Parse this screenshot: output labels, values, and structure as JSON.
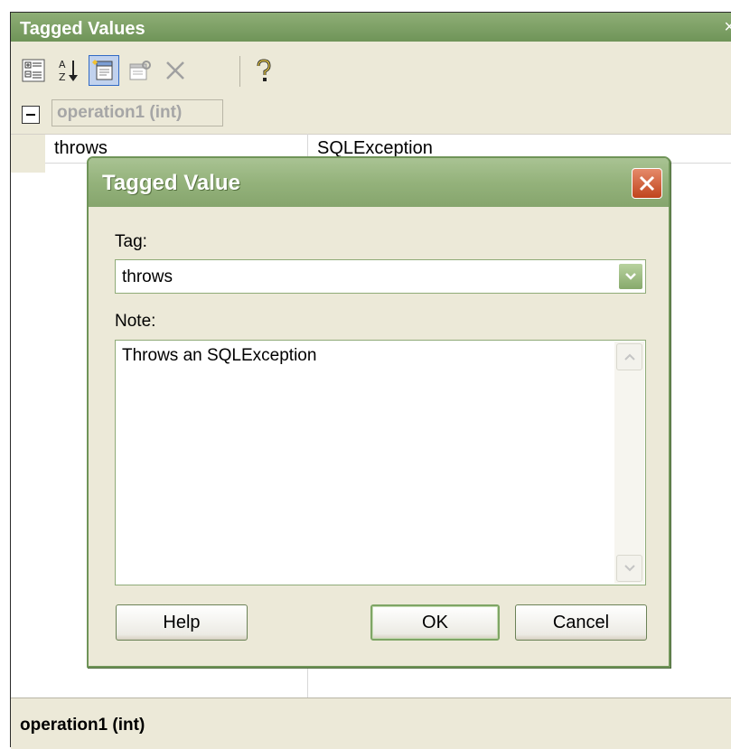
{
  "panel": {
    "title": "Tagged Values",
    "close_glyph": "×",
    "toolbar": {
      "buttons": [
        {
          "name": "categorized-icon"
        },
        {
          "name": "sort-alphabetical-icon"
        },
        {
          "name": "new-tagged-value-icon",
          "active": true
        },
        {
          "name": "properties-icon"
        },
        {
          "name": "delete-icon"
        },
        {
          "name": "help-icon"
        }
      ]
    },
    "group": {
      "label": "operation1 (int)"
    },
    "rows": [
      {
        "tag": "throws",
        "value": "SQLException"
      }
    ],
    "status": "operation1 (int)"
  },
  "dialog": {
    "title": "Tagged Value",
    "tag_label": "Tag:",
    "tag_value": "throws",
    "note_label": "Note:",
    "note_value": "Throws an SQLException",
    "buttons": {
      "help": "Help",
      "ok": "OK",
      "cancel": "Cancel"
    }
  },
  "colors": {
    "title_green": "#6f9458",
    "chrome": "#ece9d8",
    "close_red": "#c0441d"
  }
}
